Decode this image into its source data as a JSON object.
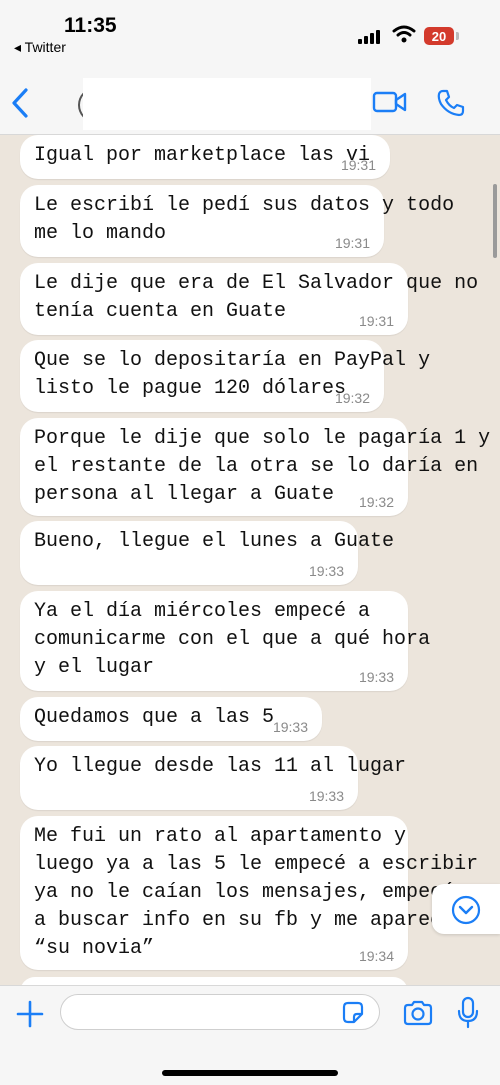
{
  "status_bar": {
    "time": "11:35",
    "back_app": "◂ Twitter",
    "battery": "20"
  },
  "chat": {
    "messages": [
      {
        "text": "Igual por marketplace las vi",
        "time": "19:31"
      },
      {
        "text": "Le escribí le pedí sus datos y todo\nme lo mando",
        "time": "19:31"
      },
      {
        "text": "Le dije que era de El Salvador que no\ntenía cuenta en Guate",
        "time": "19:31"
      },
      {
        "text": "Que se lo depositaría en PayPal y\nlisto le pague 120 dólares",
        "time": "19:32"
      },
      {
        "text": "Porque le dije que solo le pagaría 1 y\nel restante de la otra se lo daría en\npersona al llegar a Guate",
        "time": "19:32"
      },
      {
        "text": "Bueno, llegue el lunes a Guate",
        "time": "19:33"
      },
      {
        "text": "Ya el día miércoles empecé a\ncomunicarme con el que a qué hora\ny el lugar",
        "time": "19:33"
      },
      {
        "text": "Quedamos que a las 5",
        "time": "19:33"
      },
      {
        "text": "Yo llegue desde las 11 al lugar",
        "time": "19:33"
      },
      {
        "text": "Me fui un rato al apartamento y\nluego ya a las 5 le empecé a escribir\nya no le caían los mensajes, empecé\na buscar info en su fb y me apareció\n“su novia”",
        "time": "19:34"
      }
    ]
  },
  "input": {
    "value": "",
    "placeholder": ""
  },
  "colors": {
    "accent": "#1b7ef6",
    "bubble": "#ffffff",
    "background": "#ece5dc",
    "battery": "#d33a2c"
  }
}
